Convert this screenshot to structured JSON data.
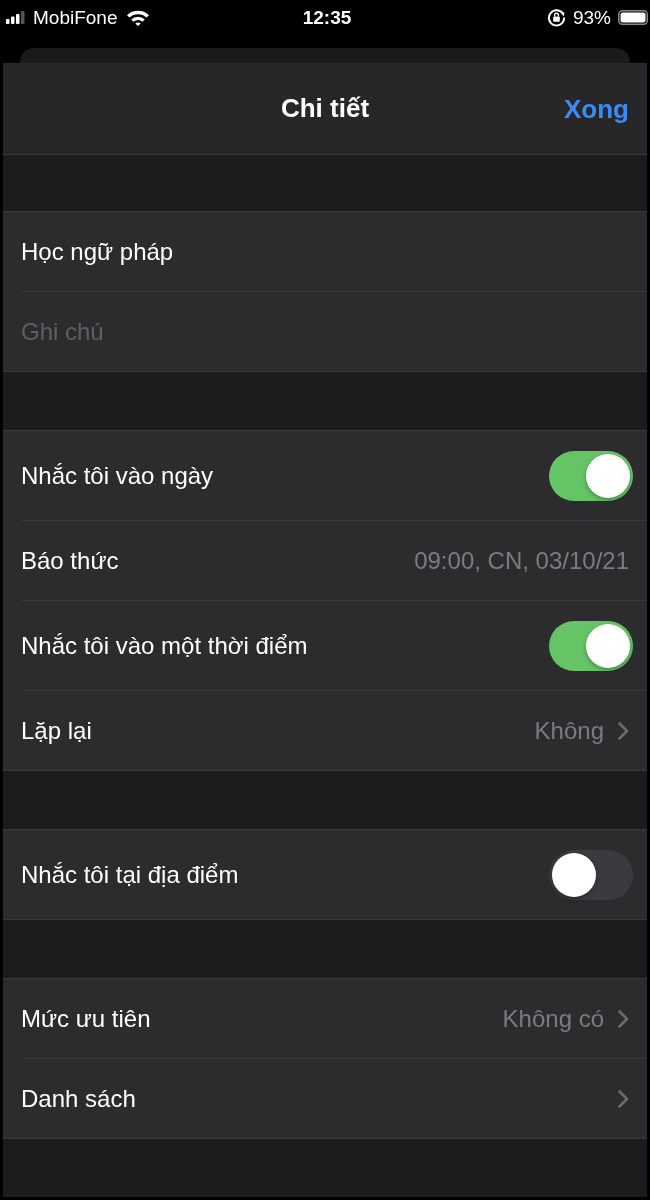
{
  "status_bar": {
    "carrier": "MobiFone",
    "time": "12:35",
    "battery": "93%"
  },
  "header": {
    "title": "Chi tiết",
    "done_button": "Xong"
  },
  "sections": [
    {
      "rows": [
        {
          "kind": "field",
          "value": "Học ngữ pháp"
        },
        {
          "kind": "field",
          "placeholder": "Ghi chú"
        }
      ]
    },
    {
      "rows": [
        {
          "kind": "toggle",
          "label": "Nhắc tôi vào ngày",
          "on": true
        },
        {
          "kind": "detail",
          "label": "Báo thức",
          "value": "09:00, CN, 03/10/21",
          "chevron": false
        },
        {
          "kind": "toggle",
          "label": "Nhắc tôi vào một thời điểm",
          "on": true
        },
        {
          "kind": "detail",
          "label": "Lặp lại",
          "value": "Không",
          "chevron": true
        }
      ]
    },
    {
      "rows": [
        {
          "kind": "toggle",
          "label": "Nhắc tôi tại địa điểm",
          "on": false
        }
      ]
    },
    {
      "rows": [
        {
          "kind": "detail",
          "label": "Mức ưu tiên",
          "value": "Không có",
          "chevron": true
        },
        {
          "kind": "detail",
          "label": "Danh sách",
          "chevron": true
        }
      ]
    }
  ]
}
